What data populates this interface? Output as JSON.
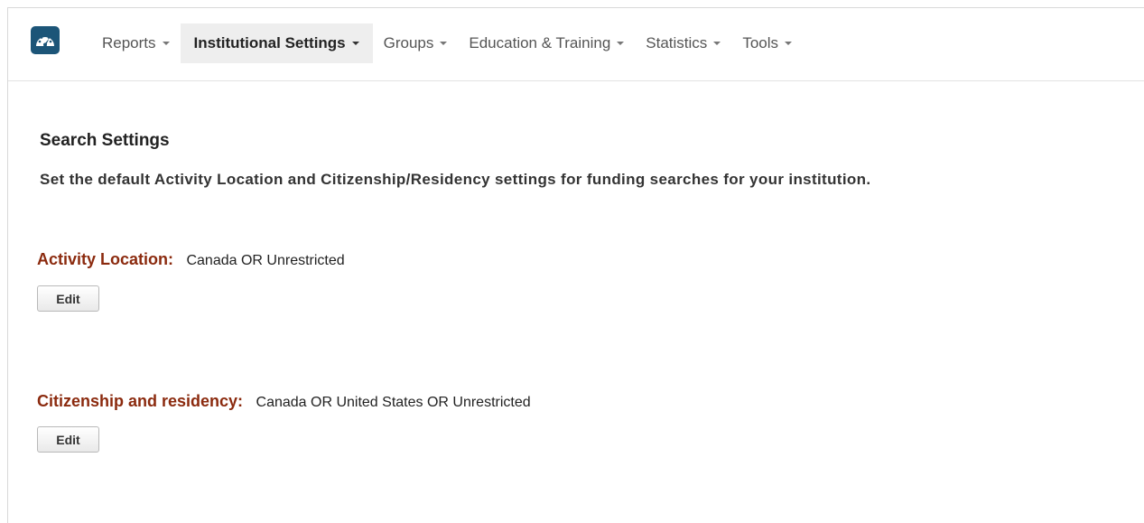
{
  "nav": {
    "items": [
      {
        "label": "Reports"
      },
      {
        "label": "Institutional Settings"
      },
      {
        "label": "Groups"
      },
      {
        "label": "Education & Training"
      },
      {
        "label": "Statistics"
      },
      {
        "label": "Tools"
      }
    ],
    "active_index": 1,
    "logo_icon": "dashboard-gauge-icon"
  },
  "page": {
    "title": "Search Settings",
    "description": "Set the default Activity Location and Citizenship/Residency settings for funding searches for your institution."
  },
  "settings": {
    "activity_location": {
      "label": "Activity Location:",
      "value": "Canada OR Unrestricted",
      "button_label": "Edit"
    },
    "citizenship": {
      "label": "Citizenship and residency:",
      "value": "Canada OR United States OR Unrestricted",
      "button_label": "Edit"
    }
  },
  "colors": {
    "logo_bg": "#1c5578",
    "label_color": "#8b2a0e",
    "active_nav_bg": "#eeeeee"
  }
}
